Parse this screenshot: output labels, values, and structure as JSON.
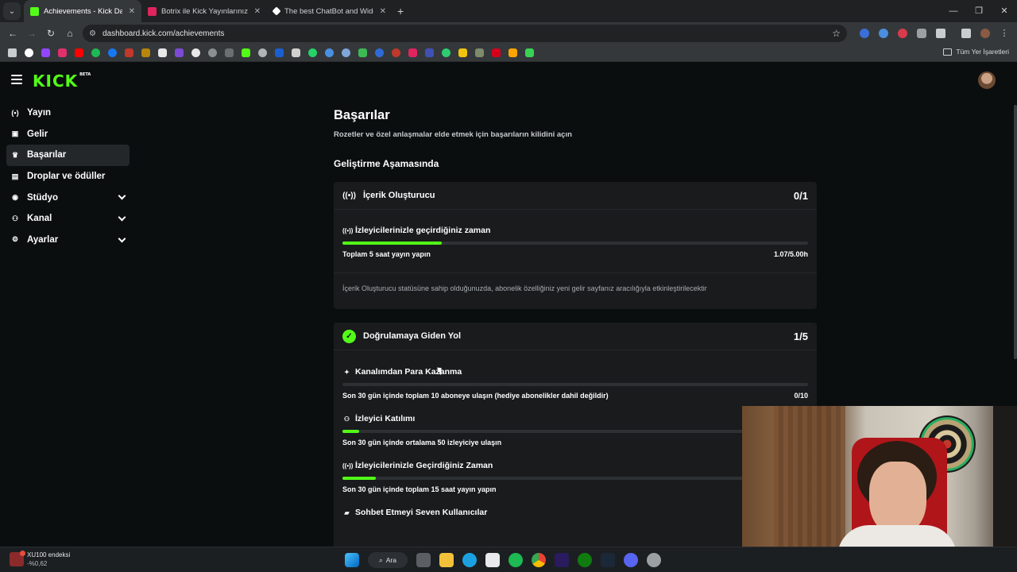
{
  "browser": {
    "tabs": [
      {
        "title": "Achievements - Kick Dashboard",
        "favicon_color": "#53fc18",
        "active": true
      },
      {
        "title": "Botrix ile Kick Yayınlarınızı Daha",
        "favicon_color": "#e0245e",
        "active": false
      },
      {
        "title": "The best ChatBot and Widgets",
        "favicon_color": "#ffffff",
        "active": false
      }
    ],
    "url": "dashboard.kick.com/achievements",
    "bookmarks_all_label": "Tüm Yer İşaretleri"
  },
  "kick": {
    "logo": "KICK",
    "logo_badge": "BETA",
    "sidebar": [
      {
        "label": "Yayın",
        "icon": "broadcast-icon",
        "glyph": "(•)",
        "active": false,
        "expandable": false
      },
      {
        "label": "Gelir",
        "icon": "wallet-icon",
        "glyph": "▣",
        "active": false,
        "expandable": false
      },
      {
        "label": "Başarılar",
        "icon": "trophy-icon",
        "glyph": "♛",
        "active": true,
        "expandable": false
      },
      {
        "label": "Droplar ve ödüller",
        "icon": "gift-icon",
        "glyph": "▤",
        "active": false,
        "expandable": false
      },
      {
        "label": "Stüdyo",
        "icon": "palette-icon",
        "glyph": "◉",
        "active": false,
        "expandable": true
      },
      {
        "label": "Kanal",
        "icon": "users-icon",
        "glyph": "⚇",
        "active": false,
        "expandable": true
      },
      {
        "label": "Ayarlar",
        "icon": "gear-icon",
        "glyph": "⚙",
        "active": false,
        "expandable": true
      }
    ],
    "title": "Başarılar",
    "subtitle": "Rozetler ve özel anlaşmalar elde etmek için başarıların kilidini açın",
    "section": "Geliştirme Aşamasında",
    "cards": [
      {
        "title": "İçerik Oluşturucu",
        "count": "0/1",
        "requirements": [
          {
            "title": "İzleyicilerinizle geçirdiğiniz zaman",
            "desc": "Toplam 5 saat yayın yapın",
            "value": "1.07/5.00h",
            "progress": 0.214
          }
        ],
        "note": "İçerik Oluşturucu statüsüne sahip olduğunuzda, abonelik özelliğiniz yeni gelir sayfanız aracılığıyla etkinleştirilecektir"
      },
      {
        "title": "Doğrulamaya Giden Yol",
        "count": "1/5",
        "requirements": [
          {
            "title": "Kanalımdan Para Kazanma",
            "desc": "Son 30 gün içinde toplam 10 aboneye ulaşın (hediye abonelikler dahil değildir)",
            "value": "0/10",
            "progress": 0.0
          },
          {
            "title": "İzleyici Katılımı",
            "desc": "Son 30 gün içinde ortalama 50 izleyiciye ulaşın",
            "value": "",
            "progress": 0.036
          },
          {
            "title": "İzleyicilerinizle Geçirdiğiniz Zaman",
            "desc": "Son 30 gün içinde toplam 15 saat yayın yapın",
            "value": "",
            "progress": 0.071
          },
          {
            "title": "Sohbet Etmeyi Seven Kullanıcılar",
            "desc": "",
            "value": "",
            "progress": null
          }
        ]
      }
    ]
  },
  "taskbar": {
    "widget_title": "XU100 endeksi",
    "widget_value": "-%0,62",
    "search_label": "Ara"
  },
  "colors": {
    "accent": "#53fc18",
    "background": "#0b0e0f",
    "card": "#191b1d"
  }
}
